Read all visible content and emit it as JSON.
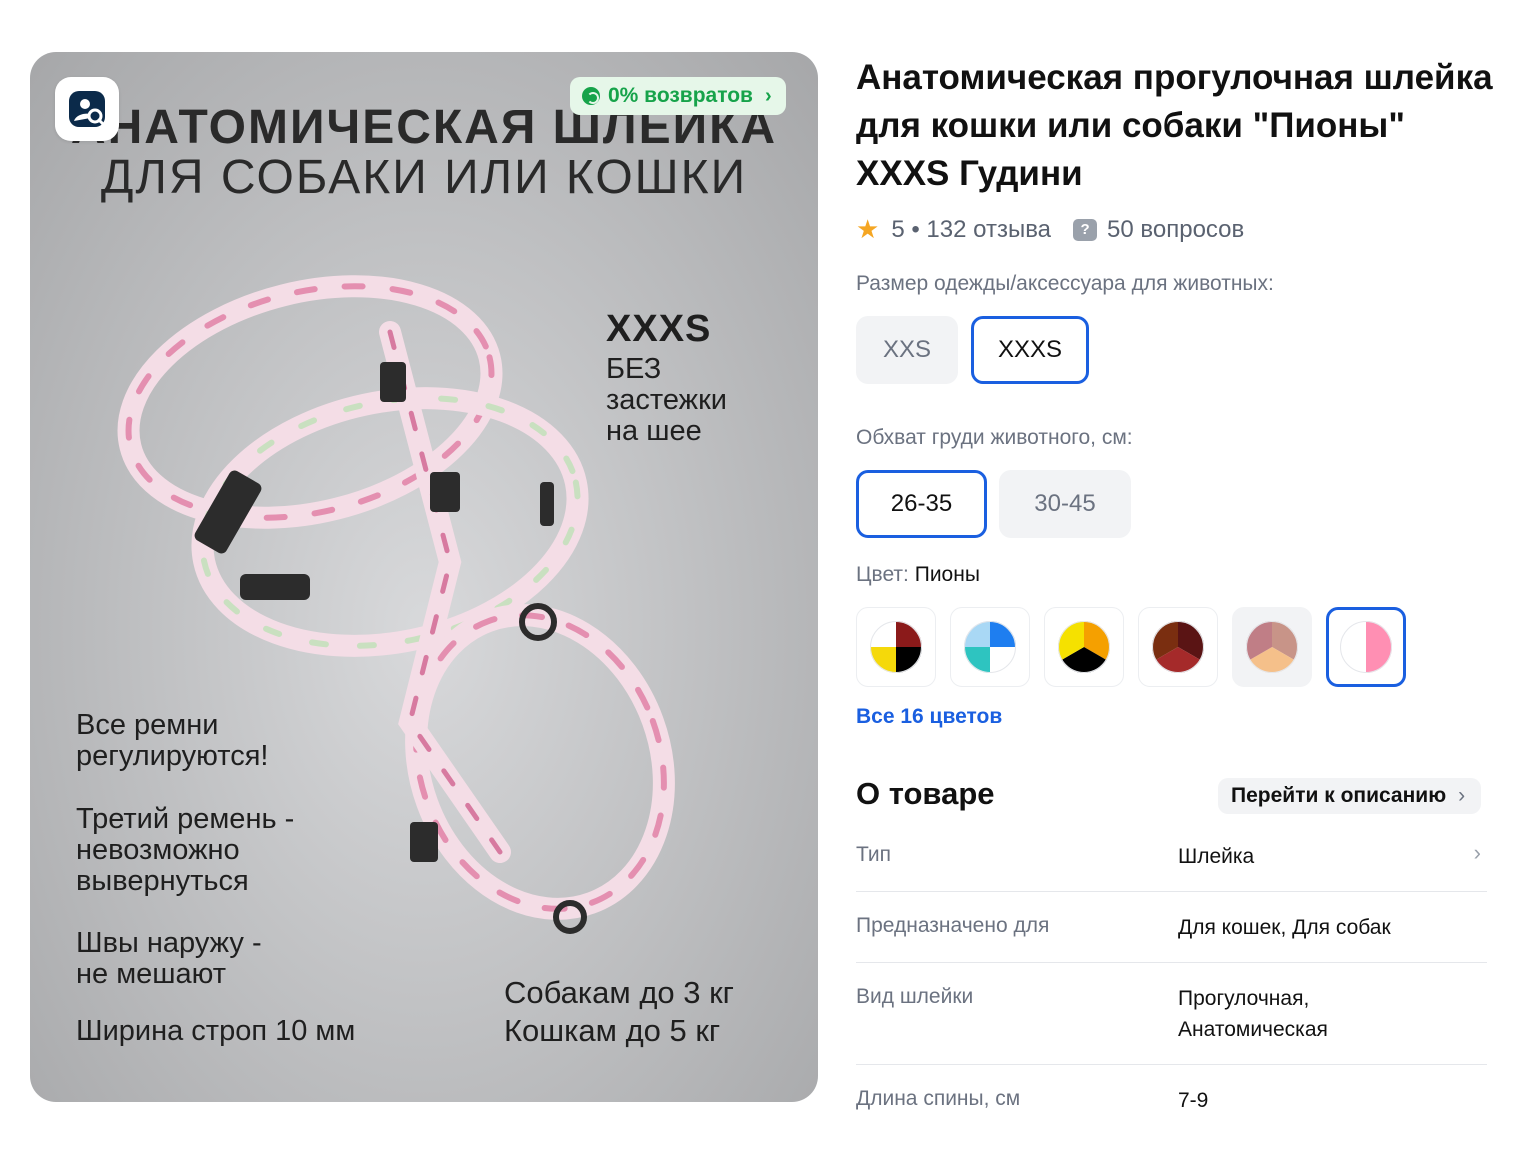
{
  "photo": {
    "returns_badge": "0% возвратов",
    "headline_1": "АНАТОМИЧЕСКАЯ ШЛЕЙКА",
    "headline_2": "ДЛЯ СОБАКИ ИЛИ КОШКИ",
    "size_label": "XXXS",
    "no_clasp": "БЕЗ\nзастежки\nна шее",
    "feature_1": "Все ремни\nрегулируются!",
    "feature_2": "Третий ремень -\nневозможно\nвывернуться",
    "feature_3": "Швы наружу -\nне мешают",
    "feature_4": "Ширина строп 10 мм",
    "weight_limits": "Собакам до 3 кг\nКошкам до 5 кг"
  },
  "product": {
    "title": "Анатомическая прогулочная шлейка для кошки или собаки \"Пионы\" XXXS Гудини",
    "rating": "5",
    "reviews": "132 отзыва",
    "questions": "50 вопросов"
  },
  "size": {
    "label": "Размер одежды/аксессуара для животных:",
    "options": [
      "XXS",
      "XXXS"
    ],
    "selected": "XXXS"
  },
  "chest": {
    "label": "Обхват груди животного, см:",
    "options": [
      "26-35",
      "30-45"
    ],
    "selected": "26-35"
  },
  "color": {
    "label": "Цвет:",
    "value": "Пионы",
    "all_link": "Все 16 цветов",
    "swatches": [
      {
        "colors": [
          "#8b1a1a",
          "#000000",
          "#f5d90a",
          "#ffffff"
        ]
      },
      {
        "colors": [
          "#1e7ef0",
          "#ffffff",
          "#2ec4c0",
          "#a9d8f5"
        ]
      },
      {
        "colors": [
          "#f5a000",
          "#000000",
          "#f5e100"
        ]
      },
      {
        "colors": [
          "#5a1414",
          "#a52a2a",
          "#7a2e10"
        ]
      },
      {
        "colors": [
          "#c89488",
          "#f5c08a",
          "#c07e86"
        ]
      },
      {
        "colors": [
          "#ff8fb3",
          "#ffffff"
        ]
      }
    ],
    "selected_index": 5
  },
  "about": {
    "heading": "О товаре",
    "goto_label": "Перейти к описанию",
    "rows": [
      {
        "key": "Тип",
        "value": "Шлейка"
      },
      {
        "key": "Предназначено для",
        "value": "Для кошек, Для собак"
      },
      {
        "key": "Вид шлейки",
        "value": "Прогулочная,\nАнатомическая"
      },
      {
        "key": "Длина спины, см",
        "value": "7-9"
      }
    ]
  }
}
